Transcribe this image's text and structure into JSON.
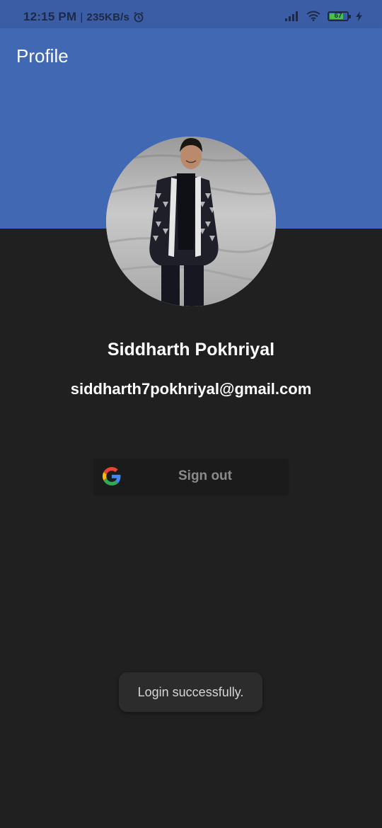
{
  "status_bar": {
    "time": "12:15 PM",
    "separator": "|",
    "net_speed": "235KB/s",
    "battery_level": "67",
    "icons": [
      "alarm-icon",
      "signal-icon",
      "wifi-icon",
      "battery-icon",
      "charging-icon"
    ]
  },
  "app_bar": {
    "title": "Profile"
  },
  "profile": {
    "avatar": "profile-photo",
    "name": "Siddharth Pokhriyal",
    "email": "siddharth7pokhriyal@gmail.com"
  },
  "sign_out": {
    "icon": "google-icon",
    "label": "Sign out"
  },
  "toast": {
    "message": "Login successfully."
  },
  "colors": {
    "app_bar": "#4169b3",
    "status_bar": "#3a5da5",
    "background": "#202020",
    "button_background": "#1b1b1b",
    "button_text": "#8a8a8a",
    "toast_background": "#2c2c2c"
  }
}
